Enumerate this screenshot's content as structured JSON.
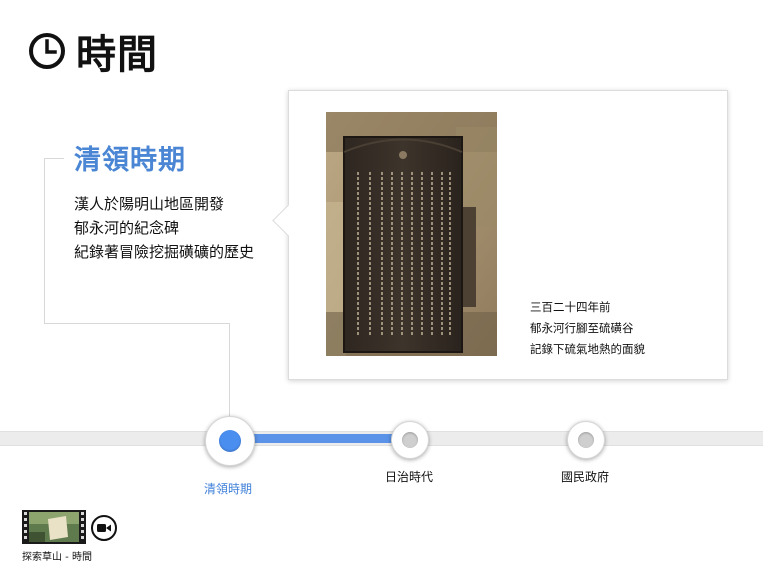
{
  "header": {
    "title": "時間",
    "icon": "clock-icon"
  },
  "era": {
    "title": "清領時期",
    "description": [
      "漢人於陽明山地區開發",
      "郁永河的紀念碑",
      "紀錄著冒險挖掘磺礦的歷史"
    ]
  },
  "card": {
    "caption": [
      "三百二十四年前",
      "郁永河行腳至硫磺谷",
      "記錄下硫氣地熱的面貌"
    ]
  },
  "timeline": {
    "active_index": 0,
    "nodes": [
      {
        "label": "清領時期"
      },
      {
        "label": "日治時代"
      },
      {
        "label": "國民政府"
      }
    ]
  },
  "footer": {
    "label": "探索草山 - 時間",
    "video_icon": "video-camera-icon"
  },
  "colors": {
    "accent": "#4a86d4",
    "progress": "#5b93e8",
    "text": "#111111"
  }
}
